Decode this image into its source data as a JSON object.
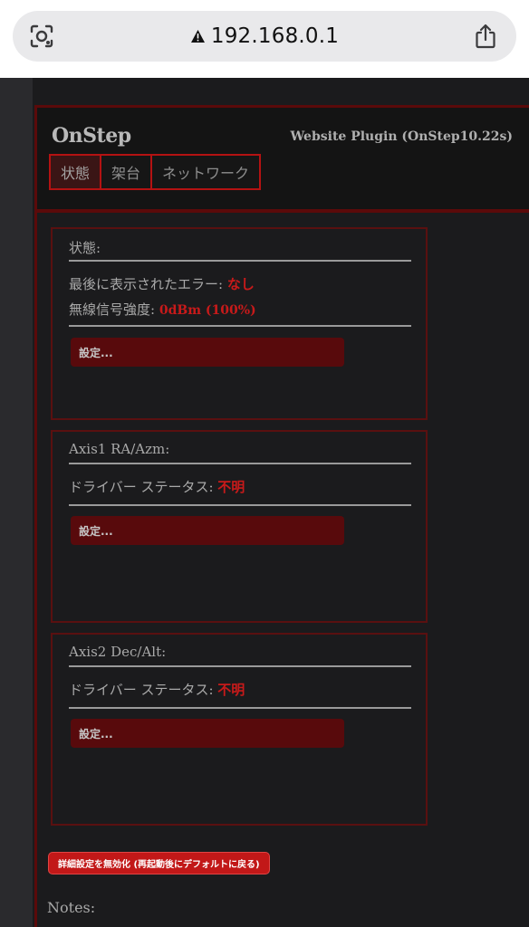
{
  "browser": {
    "url": "192.168.0.1"
  },
  "header": {
    "brand": "OnStep",
    "plugin": "Website Plugin (OnStep10.22s)",
    "tabs": [
      "状態",
      "架台",
      "ネットワーク"
    ],
    "active_tab": 0
  },
  "status_panel": {
    "title": "状態:",
    "error_label": "最後に表示されたエラー: ",
    "error_value": "なし",
    "signal_label": "無線信号強度: ",
    "signal_value": "0dBm (100%)",
    "button": "設定..."
  },
  "axis1_panel": {
    "title": "Axis1 RA/Azm:",
    "driver_label": "ドライバー ステータス: ",
    "driver_value": "不明",
    "button": "設定..."
  },
  "axis2_panel": {
    "title": "Axis2 Dec/Alt:",
    "driver_label": "ドライバー ステータス: ",
    "driver_value": "不明",
    "button": "設定..."
  },
  "footer": {
    "reset_button": "詳細設定を無効化 (再起動後にデフォルトに戻る)",
    "notes_label": "Notes:"
  },
  "colors": {
    "accent": "#c81a1a",
    "border": "#5b0a0a",
    "button": "#580a0c",
    "background": "#1b1b1d"
  }
}
